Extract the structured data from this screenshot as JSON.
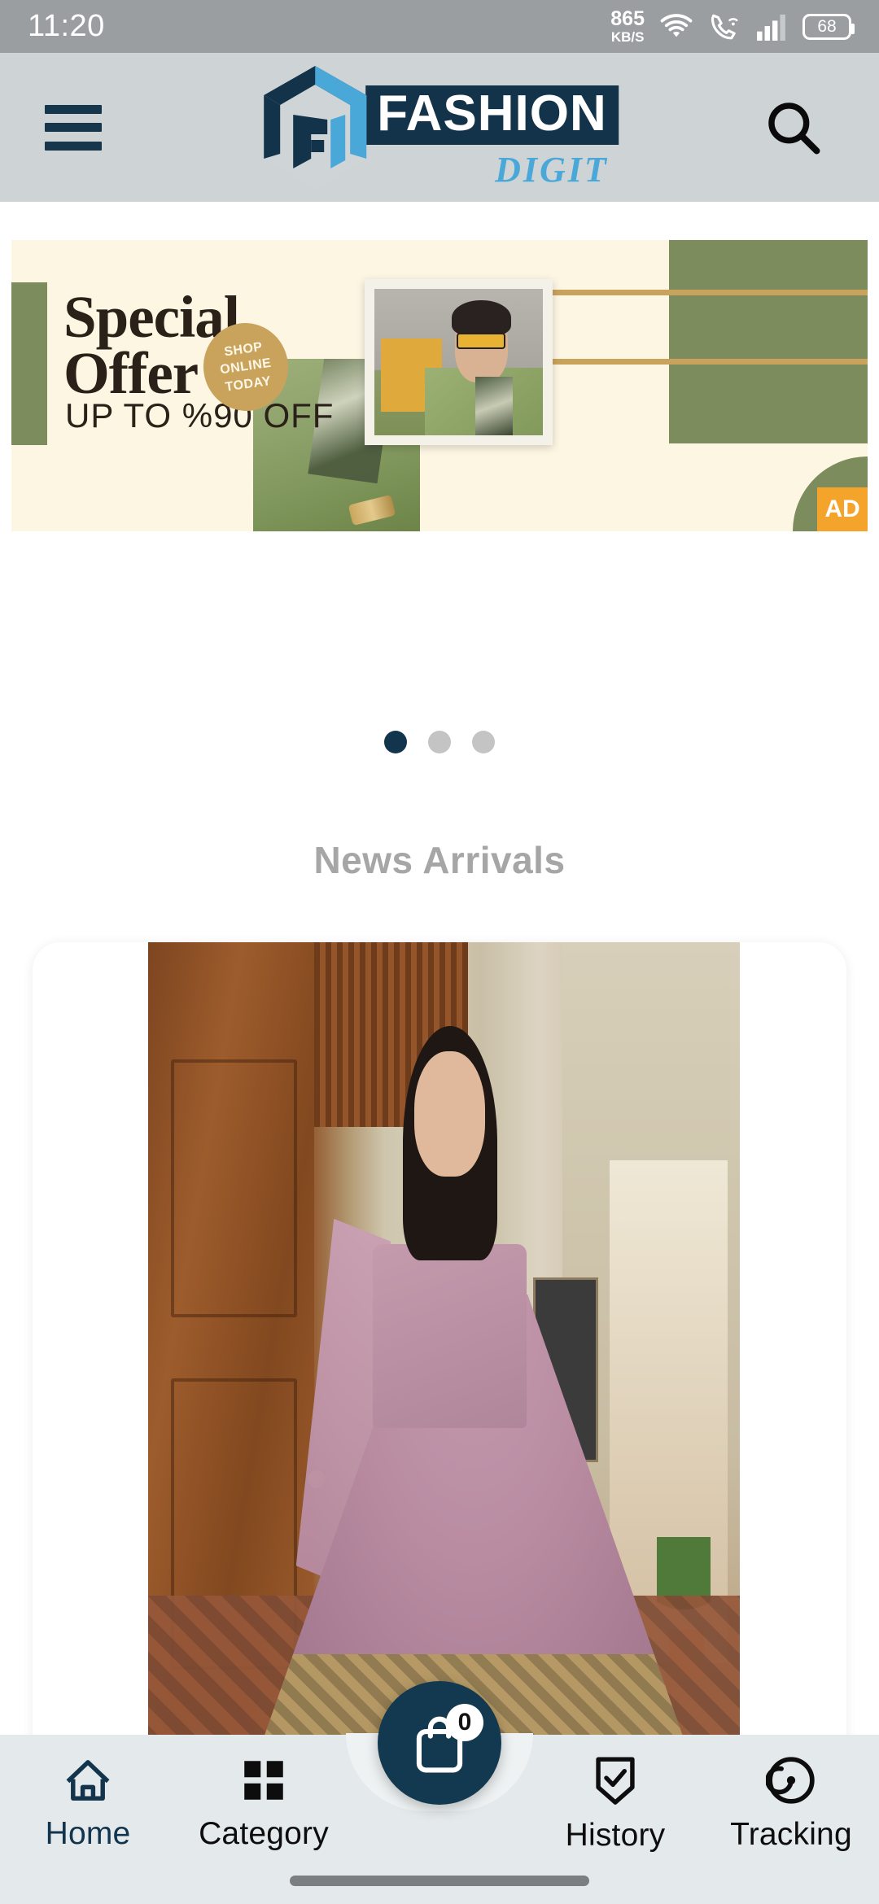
{
  "status_bar": {
    "time": "11:20",
    "network_speed_value": "865",
    "network_speed_unit": "KB/S",
    "wifi_icon": "wifi-icon",
    "call_icon": "vowifi-call-icon",
    "signal_icon": "cellular-signal-icon",
    "battery_level": "68"
  },
  "header": {
    "menu_icon": "hamburger-menu-icon",
    "brand_name": "FASHION",
    "brand_sub": "DIGIT",
    "logo_icon": "fd-hexagon-logo-icon",
    "search_icon": "search-icon",
    "colors": {
      "bar_bg": "#ced3d6",
      "brand_navy": "#13334a",
      "brand_blue": "#4aa8d8"
    }
  },
  "banner": {
    "title_line1": "Special",
    "title_line2": "Offer",
    "subtitle": "UP TO %90 OFF",
    "badge_line1": "SHOP",
    "badge_line2": "ONLINE",
    "badge_line3": "TODAY",
    "ad_label": "AD",
    "colors": {
      "cream": "#fdf6e3",
      "olive": "#7d8c5c",
      "gold": "#c9a35c",
      "ad_orange": "#f5a42b",
      "text_dark": "#2b2118"
    }
  },
  "carousel": {
    "total_dots": 3,
    "active_index": 0,
    "active_color": "#12344d",
    "inactive_color": "#c4c4c4"
  },
  "section": {
    "title": "News Arrivals",
    "title_color": "#a6a6a6"
  },
  "product_card": {
    "image_alt": "woman-in-pink-lehenga-product-photo"
  },
  "bottom_nav": {
    "items": [
      {
        "label": "Home",
        "icon": "home-icon",
        "active": true
      },
      {
        "label": "Category",
        "icon": "grid-icon",
        "active": false
      },
      {
        "label": "History",
        "icon": "shield-check-icon",
        "active": false
      },
      {
        "label": "Tracking",
        "icon": "tracking-target-icon",
        "active": false
      }
    ],
    "cart": {
      "icon": "shopping-bag-icon",
      "badge_count": "0",
      "bg_color": "#12394f"
    },
    "bar_bg": "#e4e9eb",
    "active_color": "#12344d"
  }
}
